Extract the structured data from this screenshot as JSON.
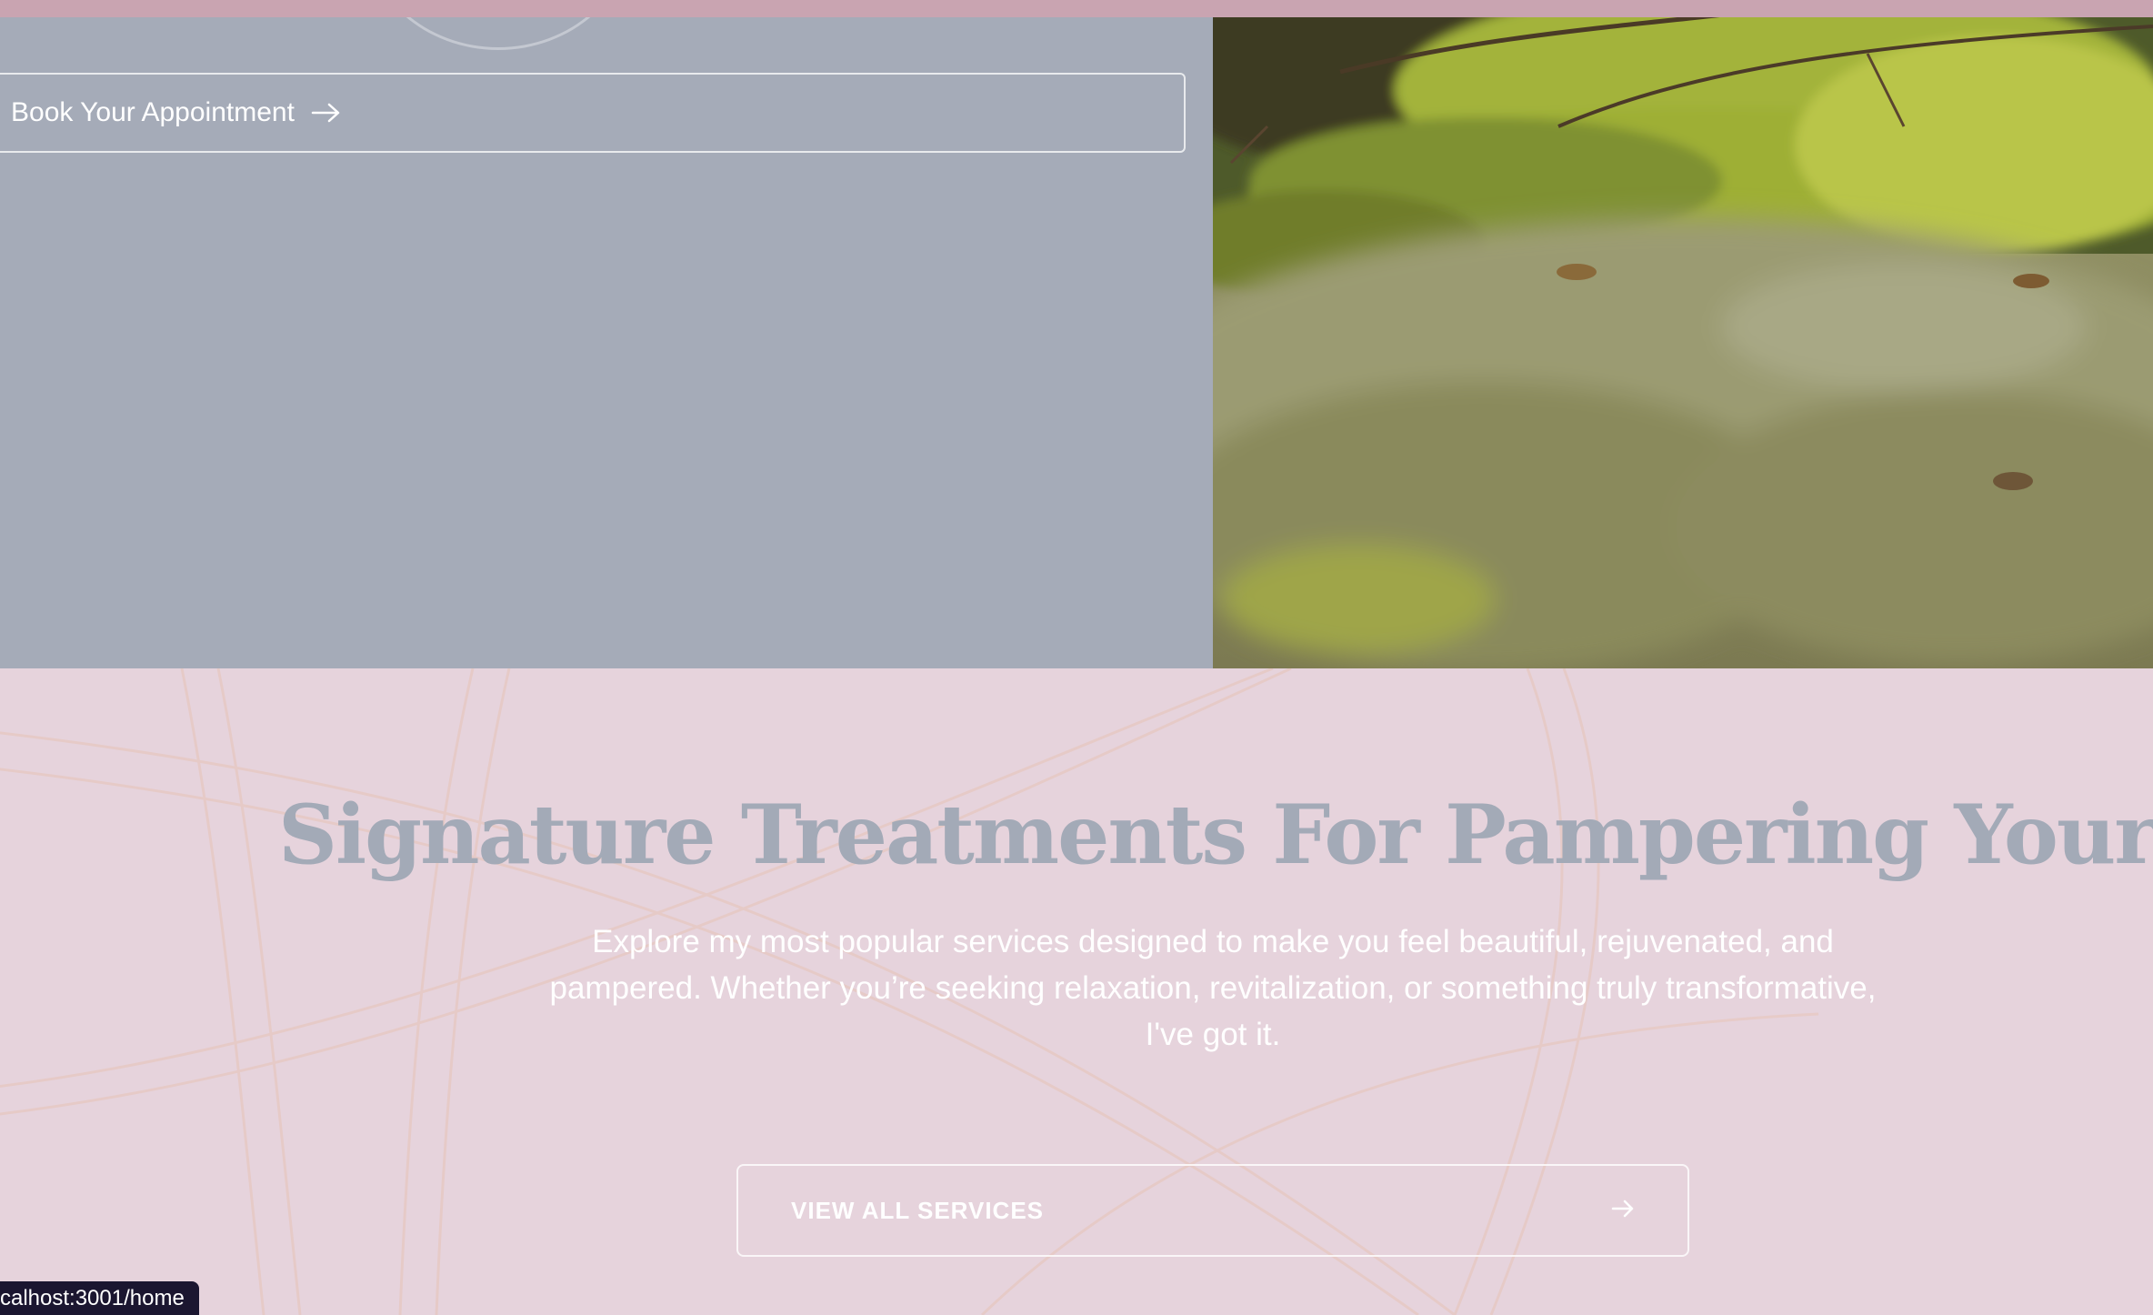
{
  "hero": {
    "book_button_label": "Book Your Appointment",
    "image_alt": "moss-covered forest floor"
  },
  "services": {
    "heading": "Signature Treatments For Pampering Yourself",
    "description": "Explore my most popular services designed to make you feel beautiful, rejuvenated, and pampered. Whether you’re seeking relaxation, revitalization, or something truly transformative, I've got it.",
    "button_label": "VIEW ALL SERVICES"
  },
  "status_bar": {
    "url": "calhost:3001/home"
  },
  "colors": {
    "background_pink": "#e6d3dc",
    "hero_slate": "#a5abb8",
    "heading_slate": "#a3aab7",
    "status_bg": "#1b1630"
  },
  "icons": [
    "arrow-right-icon",
    "arrow-right-icon"
  ]
}
